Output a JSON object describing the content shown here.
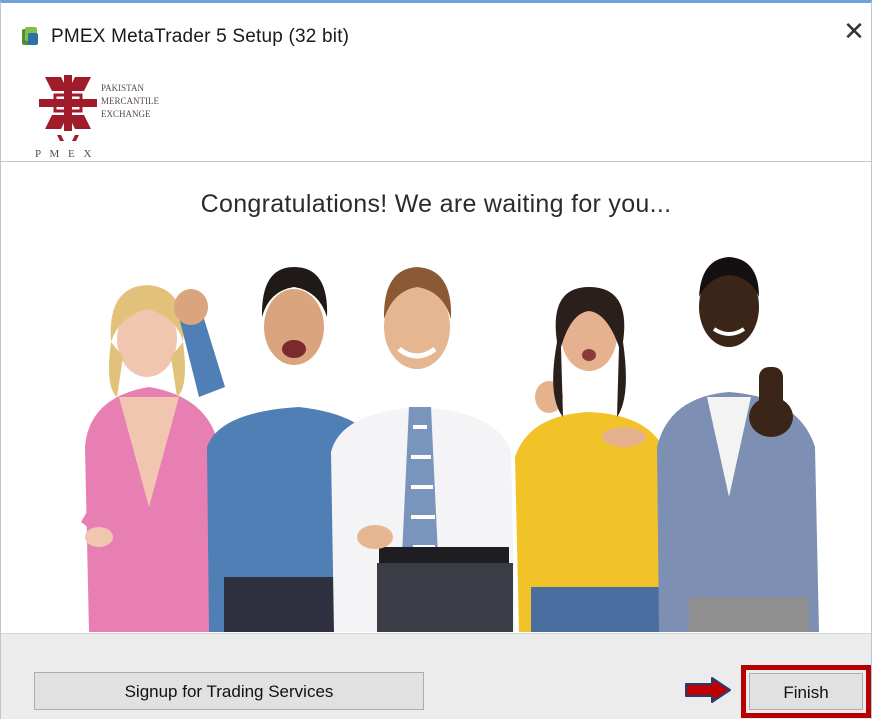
{
  "window": {
    "title": "PMEX MetaTrader 5 Setup (32 bit)",
    "close_glyph": "✕"
  },
  "logo": {
    "lines": [
      "PAKISTAN",
      "MERCANTILE",
      "EXCHANGE"
    ],
    "acronym": "P M E X"
  },
  "main": {
    "headline": "Congratulations! We are waiting for you..."
  },
  "footer": {
    "signup_label": "Signup for Trading Services",
    "finish_label": "Finish"
  },
  "colors": {
    "highlight": "#b30000",
    "arrow_fill": "#c00000",
    "arrow_stroke": "#1f3f73",
    "brand": "#a01c2a"
  },
  "icons": {
    "app": "metatrader-icon",
    "close": "close-icon",
    "arrow": "arrow-right-icon"
  }
}
